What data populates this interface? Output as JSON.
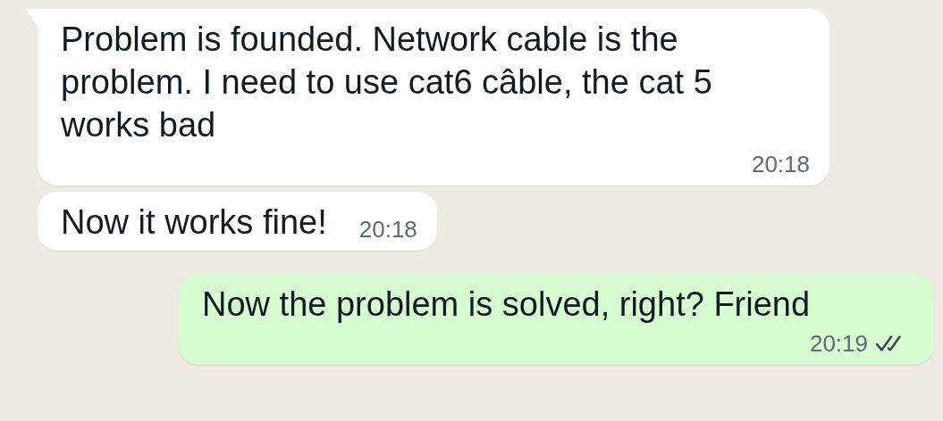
{
  "messages": [
    {
      "kind": "incoming",
      "tail": true,
      "text": "Problem is founded. Network cable is the problem. I need to use cat6 câble, the cat 5 works bad",
      "time": "20:18"
    },
    {
      "kind": "incoming",
      "tail": false,
      "text": "Now it works fine!",
      "time": "20:18"
    },
    {
      "kind": "outgoing",
      "tail": false,
      "text": "Now the problem is solved, right? Friend",
      "time": "20:19",
      "read": false
    }
  ]
}
